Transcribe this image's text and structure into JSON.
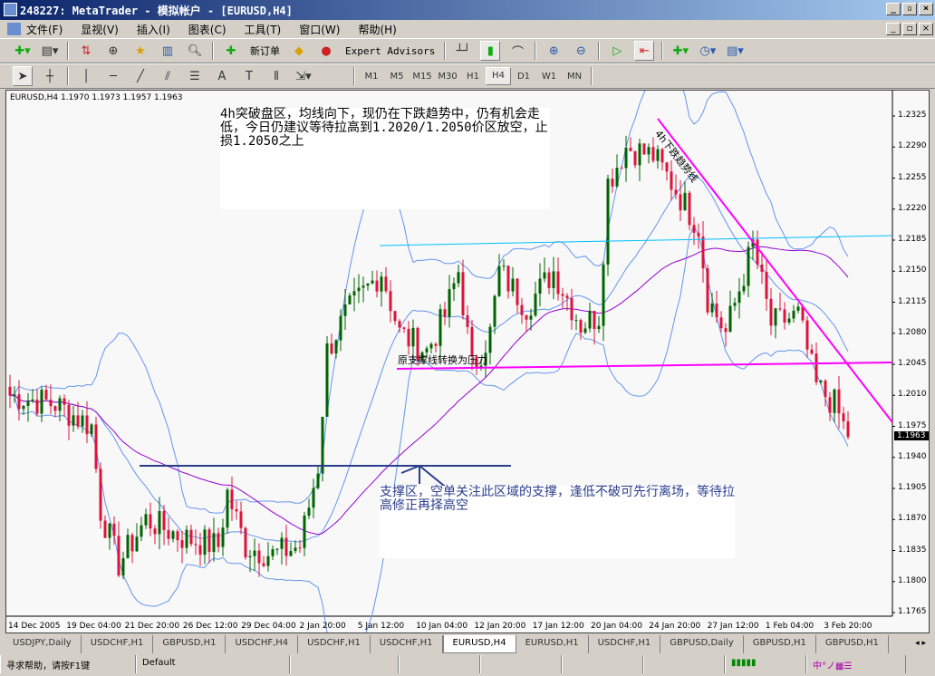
{
  "window": {
    "title": "248227: MetaTrader - 模拟帐户 - [EURUSD,H4]"
  },
  "menu": [
    "文件(F)",
    "显视(V)",
    "插入(I)",
    "图表(C)",
    "工具(T)",
    "窗口(W)",
    "帮助(H)"
  ],
  "toolbar": {
    "new_order": "新订单",
    "expert_advisors": "Expert Advisors"
  },
  "timeframes": [
    "M1",
    "M5",
    "M15",
    "M30",
    "H1",
    "H4",
    "D1",
    "W1",
    "MN"
  ],
  "active_timeframe": "H4",
  "chart": {
    "info": "EURUSD,H4  1.1970 1.1973 1.1957 1.1963",
    "note1": "4h突破盘区，均线向下，现仍在下跌趋势中，仍有机会走低，今日仍建议等待拉高到1.2020/1.2050价区放空，止损1.2050之上",
    "note2": "支撑区，空单关注此区域的支撑，逢低不破可先行离场，等待拉高修正再择高空",
    "label_resistance": "原支撑线转换为压力",
    "label_trend": "4h下跌趋势线",
    "current_price": "1.1963",
    "colors": {
      "bull": "#006400",
      "bear": "#dc143c",
      "bands": "#6495ed",
      "ma": "#9400d3",
      "trend": "#ff00ff",
      "cyan": "#00bfff",
      "support": "#2a3e8c"
    }
  },
  "chart_data": {
    "type": "candlestick",
    "symbol": "EURUSD",
    "timeframe": "H4",
    "ohlc_last": {
      "open": 1.197,
      "high": 1.1973,
      "low": 1.1957,
      "close": 1.1963
    },
    "ylim": [
      1.1748,
      1.2368
    ],
    "y_ticks": [
      "1.2325",
      "1.2290",
      "1.2255",
      "1.2220",
      "1.2185",
      "1.2150",
      "1.2115",
      "1.2080",
      "1.2045",
      "1.2010",
      "1.1975",
      "1.1940",
      "1.1905",
      "1.1870",
      "1.1835",
      "1.1800",
      "1.1765"
    ],
    "x_ticks": [
      "14 Dec 2005",
      "19 Dec 04:00",
      "21 Dec 20:00",
      "26 Dec 12:00",
      "29 Dec 04:00",
      "2 Jan 20:00",
      "5 Jan 12:00",
      "10 Jan 04:00",
      "12 Jan 20:00",
      "17 Jan 12:00",
      "20 Jan 04:00",
      "24 Jan 20:00",
      "27 Jan 12:00",
      "1 Feb 04:00",
      "3 Feb 20:00"
    ],
    "close_path": [
      [
        0,
        1.201
      ],
      [
        10,
        1.2
      ],
      [
        18,
        1.1975
      ],
      [
        20,
        1.188
      ],
      [
        24,
        1.182
      ],
      [
        30,
        1.187
      ],
      [
        38,
        1.185
      ],
      [
        46,
        1.184
      ],
      [
        48,
        1.19
      ],
      [
        52,
        1.184
      ],
      [
        58,
        1.183
      ],
      [
        64,
        1.184
      ],
      [
        68,
        1.193
      ],
      [
        70,
        1.206
      ],
      [
        74,
        1.21
      ],
      [
        82,
        1.215
      ],
      [
        86,
        1.208
      ],
      [
        92,
        1.206
      ],
      [
        96,
        1.21
      ],
      [
        99,
        1.215
      ],
      [
        102,
        1.204
      ],
      [
        106,
        1.208
      ],
      [
        108,
        1.215
      ],
      [
        114,
        1.211
      ],
      [
        120,
        1.215
      ],
      [
        126,
        1.209
      ],
      [
        130,
        1.21
      ],
      [
        132,
        1.225
      ],
      [
        136,
        1.229
      ],
      [
        142,
        1.228
      ],
      [
        146,
        1.225
      ],
      [
        152,
        1.22
      ],
      [
        154,
        1.212
      ],
      [
        158,
        1.208
      ],
      [
        164,
        1.218
      ],
      [
        168,
        1.209
      ],
      [
        174,
        1.21
      ],
      [
        178,
        1.202
      ],
      [
        182,
        1.2
      ],
      [
        185,
        1.1963
      ]
    ],
    "indicators": [
      "Bollinger Bands(20,2)",
      "Moving Average"
    ]
  },
  "tabs": [
    "USDJPY,Daily",
    "USDCHF,H1",
    "GBPUSD,H1",
    "USDCHF,H4",
    "USDCHF,H1",
    "USDCHF,H1",
    "EURUSD,H4",
    "EURUSD,H1",
    "USDCHF,H1",
    "GBPUSD,Daily",
    "GBPUSD,H1",
    "GBPUSD,H1"
  ],
  "active_tab": 6,
  "status": {
    "help": "寻求帮助，请按F1键",
    "profile": "Default"
  }
}
